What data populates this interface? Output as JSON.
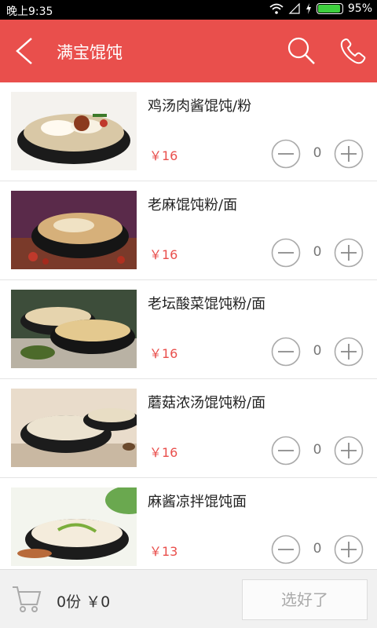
{
  "status_bar": {
    "time": "晚上9:35",
    "battery": "95%",
    "battery_level": 0.95
  },
  "header": {
    "title": "满宝馄饨"
  },
  "items": [
    {
      "name": "鸡汤肉酱馄饨/粉",
      "price": "￥16",
      "qty": "0"
    },
    {
      "name": "老麻馄饨粉/面",
      "price": "￥16",
      "qty": "0"
    },
    {
      "name": "老坛酸菜馄饨粉/面",
      "price": "￥16",
      "qty": "0"
    },
    {
      "name": "蘑菇浓汤馄饨粉/面",
      "price": "￥16",
      "qty": "0"
    },
    {
      "name": "麻酱凉拌馄饨面",
      "price": "￥13",
      "qty": "0"
    }
  ],
  "bottom": {
    "summary": "0份 ￥0",
    "confirm_label": "选好了"
  },
  "colors": {
    "accent": "#e94f4c",
    "price": "#e94f4c",
    "battery": "#3ecf3e"
  },
  "icons": [
    "back-arrow-icon",
    "search-icon",
    "phone-icon",
    "minus-icon",
    "plus-icon",
    "cart-icon",
    "wifi-icon",
    "signal-icon",
    "charging-icon"
  ]
}
